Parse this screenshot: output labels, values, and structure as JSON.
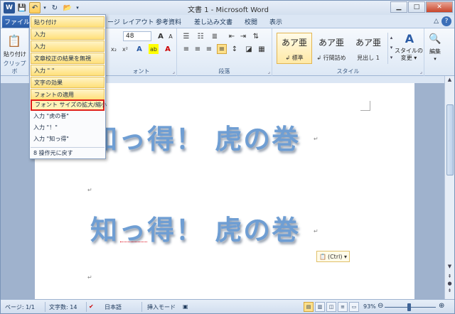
{
  "title": "文書 1 - Microsoft Word",
  "qat": {
    "word_icon": "W",
    "save_icon": "save-icon",
    "undo_icon": "undo-icon",
    "redo_icon": "redo-icon"
  },
  "tabs": [
    "ファイル",
    "ージ レイアウト",
    "参考資料",
    "差し込み文書",
    "校閲",
    "表示"
  ],
  "ribbon": {
    "paste_label": "貼り付け",
    "clipboard_group": "クリップボ",
    "font_size": "48",
    "font_group": "ォント",
    "paragraph_group": "段落",
    "styles_group": "スタイル",
    "styles": [
      {
        "sample": "あア亜",
        "name": "↲ 標準"
      },
      {
        "sample": "あア亜",
        "name": "↲ 行間詰め"
      },
      {
        "sample": "あア亜",
        "name": "見出し 1"
      }
    ],
    "style_change_label": "スタイルの",
    "style_change_label2": "変更 ▾",
    "edit_label": "編集"
  },
  "undo_menu": {
    "items": [
      "貼り付け",
      "入力",
      "入力",
      "文章校正の結果を無視",
      "入力 \" \"",
      "文字の効果",
      "フォントの適用",
      "フォント サイズの拡大/縮小",
      "入力 \"虎の巻\"",
      "入力 \"！\"",
      "入力 \"知っ得\""
    ],
    "footer": "8 操作元に戻す"
  },
  "document": {
    "line1": "知っ得！ 虎の巻",
    "line2": "知っ得！ 虎の巻",
    "paste_options": "(Ctrl) ▾"
  },
  "status": {
    "page": "ページ: 1/1",
    "words": "文字数: 14",
    "language": "日本語",
    "mode": "挿入モード",
    "zoom": "93%"
  },
  "colors": {
    "accent": "#2b5797",
    "highlight_border": "#e0201a",
    "text_effect": "#6f9ed3"
  }
}
